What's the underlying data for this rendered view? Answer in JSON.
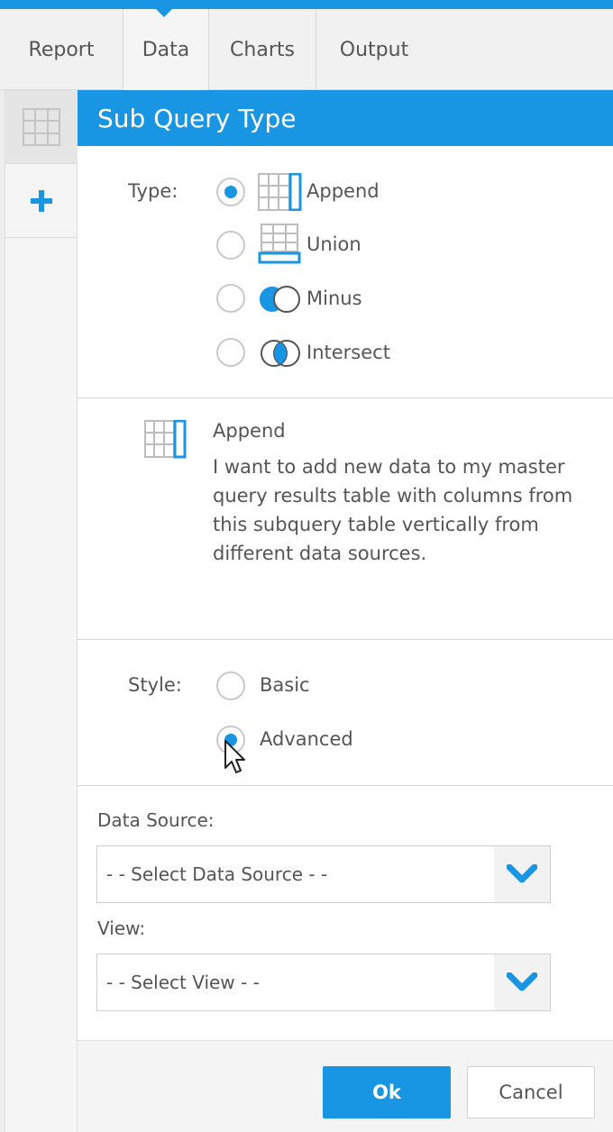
{
  "tabs": [
    {
      "label": "Report"
    },
    {
      "label": "Data"
    },
    {
      "label": "Charts"
    },
    {
      "label": "Output"
    }
  ],
  "rail": {
    "grid_icon": "grid-icon",
    "add_icon": "plus-icon"
  },
  "panel": {
    "title": "Sub Query Type"
  },
  "type_section": {
    "label": "Type:",
    "options": [
      {
        "label": "Append",
        "icon": "append-icon",
        "selected": true
      },
      {
        "label": "Union",
        "icon": "union-icon",
        "selected": false
      },
      {
        "label": "Minus",
        "icon": "minus-icon",
        "selected": false
      },
      {
        "label": "Intersect",
        "icon": "intersect-icon",
        "selected": false
      }
    ]
  },
  "description": {
    "icon": "append-icon",
    "title": "Append",
    "body": "I want to add new data to my master query results table with columns from this subquery table vertically from different data sources."
  },
  "style_section": {
    "label": "Style:",
    "options": [
      {
        "label": "Basic",
        "selected": false
      },
      {
        "label": "Advanced",
        "selected": true
      }
    ]
  },
  "data_source": {
    "label": "Data Source:",
    "value": "- - Select Data Source - -"
  },
  "view": {
    "label": "View:",
    "value": "- - Select View - -"
  },
  "buttons": {
    "ok": "Ok",
    "cancel": "Cancel"
  },
  "colors": {
    "accent": "#1996e3",
    "header_text": "#ffffff"
  }
}
